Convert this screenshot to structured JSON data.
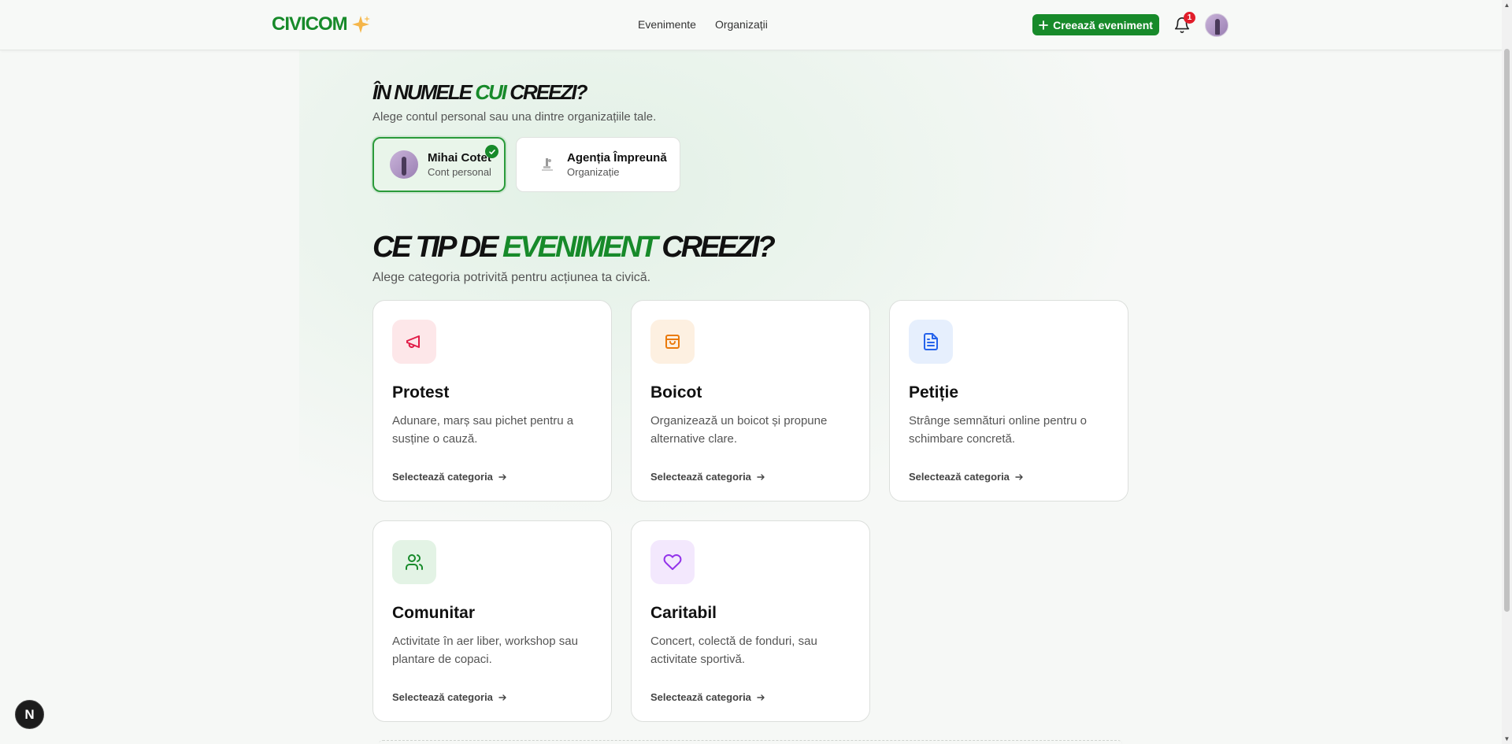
{
  "header": {
    "logo_text": "CIVICOM",
    "nav": [
      "Evenimente",
      "Organizații"
    ],
    "create_button": "Creează eveniment",
    "notification_count": "1"
  },
  "account_section": {
    "title_part1": "În numele ",
    "title_accent": "cui",
    "title_part2": " creezi?",
    "subtitle": "Alege contul personal sau una dintre organizațiile tale.",
    "accounts": [
      {
        "name": "Mihai Cotet",
        "type": "Cont personal",
        "selected": true
      },
      {
        "name": "Agenția Împreună",
        "type": "Organizație",
        "selected": false
      }
    ]
  },
  "category_section": {
    "title_part1": "Ce tip de ",
    "title_accent": "eveniment",
    "title_part2": " creezi?",
    "subtitle": "Alege categoria potrivită pentru acțiunea ta civică.",
    "cta_label": "Selectează categoria",
    "categories": [
      {
        "title": "Protest",
        "desc": "Adunare, marș sau pichet pentru a susține o cauză.",
        "icon": "megaphone-icon",
        "color": "#e11d48",
        "bg": "#fde7e9"
      },
      {
        "title": "Boicot",
        "desc": "Organizează un boicot și propune alternative clare.",
        "icon": "shopping-bag-icon",
        "color": "#ea7a0c",
        "bg": "#fdf0e1"
      },
      {
        "title": "Petiție",
        "desc": "Strânge semnături online pentru o schimbare concretă.",
        "icon": "document-icon",
        "color": "#2563eb",
        "bg": "#e6effd"
      },
      {
        "title": "Comunitar",
        "desc": "Activitate în aer liber, workshop sau plantare de copaci.",
        "icon": "users-icon",
        "color": "#178a2a",
        "bg": "#e3f3e5"
      },
      {
        "title": "Caritabil",
        "desc": "Concert, colectă de fonduri, sau activitate sportivă.",
        "icon": "heart-icon",
        "color": "#9333ea",
        "bg": "#f3e8fd"
      }
    ]
  },
  "dev_button": "N"
}
